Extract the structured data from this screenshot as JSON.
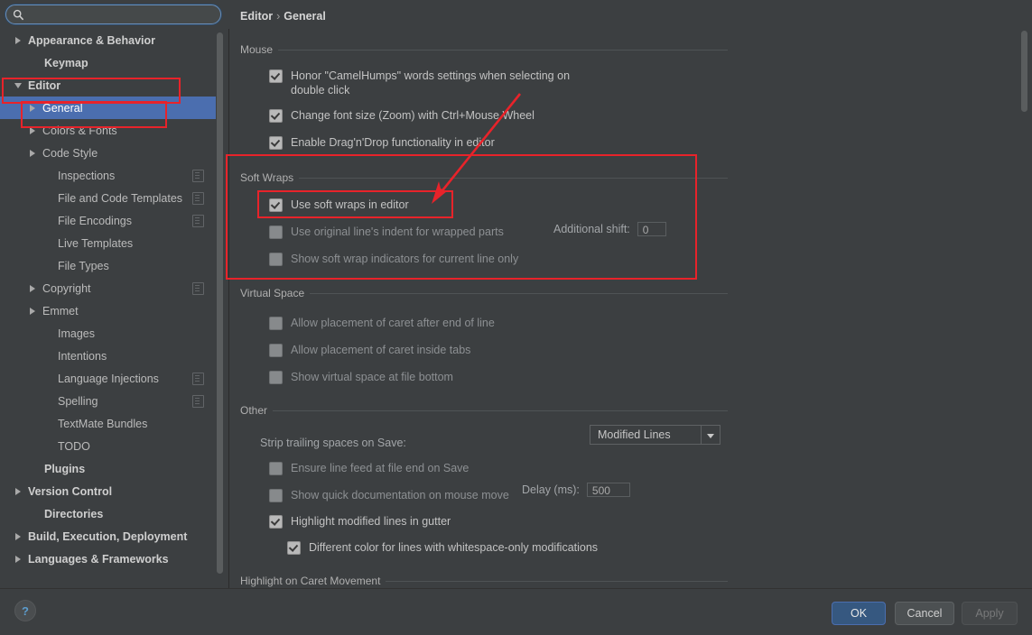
{
  "search": {
    "value": "",
    "placeholder": "",
    "icon": "search-icon"
  },
  "sidebar": {
    "items": [
      {
        "label": "Appearance & Behavior",
        "twisty": "closed",
        "indent": 14,
        "bold": true,
        "badge": false,
        "selected": false
      },
      {
        "label": "Keymap",
        "twisty": "none",
        "indent": 32,
        "bold": true,
        "badge": false,
        "selected": false
      },
      {
        "label": "Editor",
        "twisty": "open",
        "indent": 14,
        "bold": true,
        "badge": false,
        "selected": false
      },
      {
        "label": "General",
        "twisty": "closed",
        "indent": 30,
        "bold": false,
        "badge": false,
        "selected": true
      },
      {
        "label": "Colors & Fonts",
        "twisty": "closed",
        "indent": 30,
        "bold": false,
        "badge": false,
        "selected": false
      },
      {
        "label": "Code Style",
        "twisty": "closed",
        "indent": 30,
        "bold": false,
        "badge": false,
        "selected": false
      },
      {
        "label": "Inspections",
        "twisty": "none",
        "indent": 47,
        "bold": false,
        "badge": true,
        "selected": false
      },
      {
        "label": "File and Code Templates",
        "twisty": "none",
        "indent": 47,
        "bold": false,
        "badge": true,
        "selected": false
      },
      {
        "label": "File Encodings",
        "twisty": "none",
        "indent": 47,
        "bold": false,
        "badge": true,
        "selected": false
      },
      {
        "label": "Live Templates",
        "twisty": "none",
        "indent": 47,
        "bold": false,
        "badge": false,
        "selected": false
      },
      {
        "label": "File Types",
        "twisty": "none",
        "indent": 47,
        "bold": false,
        "badge": false,
        "selected": false
      },
      {
        "label": "Copyright",
        "twisty": "closed",
        "indent": 30,
        "bold": false,
        "badge": true,
        "selected": false
      },
      {
        "label": "Emmet",
        "twisty": "closed",
        "indent": 30,
        "bold": false,
        "badge": false,
        "selected": false
      },
      {
        "label": "Images",
        "twisty": "none",
        "indent": 47,
        "bold": false,
        "badge": false,
        "selected": false
      },
      {
        "label": "Intentions",
        "twisty": "none",
        "indent": 47,
        "bold": false,
        "badge": false,
        "selected": false
      },
      {
        "label": "Language Injections",
        "twisty": "none",
        "indent": 47,
        "bold": false,
        "badge": true,
        "selected": false
      },
      {
        "label": "Spelling",
        "twisty": "none",
        "indent": 47,
        "bold": false,
        "badge": true,
        "selected": false
      },
      {
        "label": "TextMate Bundles",
        "twisty": "none",
        "indent": 47,
        "bold": false,
        "badge": false,
        "selected": false
      },
      {
        "label": "TODO",
        "twisty": "none",
        "indent": 47,
        "bold": false,
        "badge": false,
        "selected": false
      },
      {
        "label": "Plugins",
        "twisty": "none",
        "indent": 32,
        "bold": true,
        "badge": false,
        "selected": false
      },
      {
        "label": "Version Control",
        "twisty": "closed",
        "indent": 14,
        "bold": true,
        "badge": false,
        "selected": false
      },
      {
        "label": "Directories",
        "twisty": "none",
        "indent": 32,
        "bold": true,
        "badge": false,
        "selected": false
      },
      {
        "label": "Build, Execution, Deployment",
        "twisty": "closed",
        "indent": 14,
        "bold": true,
        "badge": false,
        "selected": false
      },
      {
        "label": "Languages & Frameworks",
        "twisty": "closed",
        "indent": 14,
        "bold": true,
        "badge": false,
        "selected": false
      }
    ]
  },
  "breadcrumb": {
    "parent": "Editor",
    "separator": "›",
    "current": "General"
  },
  "sections": {
    "mouse": {
      "title": "Mouse",
      "options": [
        {
          "label": "Honor \"CamelHumps\" words settings when selecting on double click",
          "checked": true
        },
        {
          "label": "Change font size (Zoom) with Ctrl+Mouse Wheel",
          "checked": true
        },
        {
          "label": "Enable Drag'n'Drop functionality in editor",
          "checked": true
        }
      ]
    },
    "soft_wraps": {
      "title": "Soft Wraps",
      "options": [
        {
          "label": "Use soft wraps in editor",
          "checked": true
        },
        {
          "label": "Use original line's indent for wrapped parts",
          "checked": false
        },
        {
          "label": "Show soft wrap indicators for current line only",
          "checked": false
        }
      ],
      "additional_shift_label": "Additional shift:",
      "additional_shift_value": "0"
    },
    "virtual_space": {
      "title": "Virtual Space",
      "options": [
        {
          "label": "Allow placement of caret after end of line",
          "checked": false
        },
        {
          "label": "Allow placement of caret inside tabs",
          "checked": false
        },
        {
          "label": "Show virtual space at file bottom",
          "checked": false
        }
      ]
    },
    "other": {
      "title": "Other",
      "strip_label": "Strip trailing spaces on Save:",
      "strip_value": "Modified Lines",
      "options": [
        {
          "label": "Ensure line feed at file end on Save",
          "checked": false
        },
        {
          "label": "Show quick documentation on mouse move",
          "checked": false
        },
        {
          "label": "Highlight modified lines in gutter",
          "checked": true
        },
        {
          "label": "Different color for lines with whitespace-only modifications",
          "checked": true
        }
      ],
      "delay_label": "Delay (ms):",
      "delay_value": "500"
    },
    "caret": {
      "title": "Highlight on Caret Movement"
    }
  },
  "footer": {
    "help": "?",
    "ok": "OK",
    "cancel": "Cancel",
    "apply": "Apply"
  },
  "colors": {
    "window_bg": "#3c3f41",
    "selection_blue": "#4b6eaf",
    "annotation_red": "#e8232a",
    "ok_button_blue": "#365880"
  }
}
